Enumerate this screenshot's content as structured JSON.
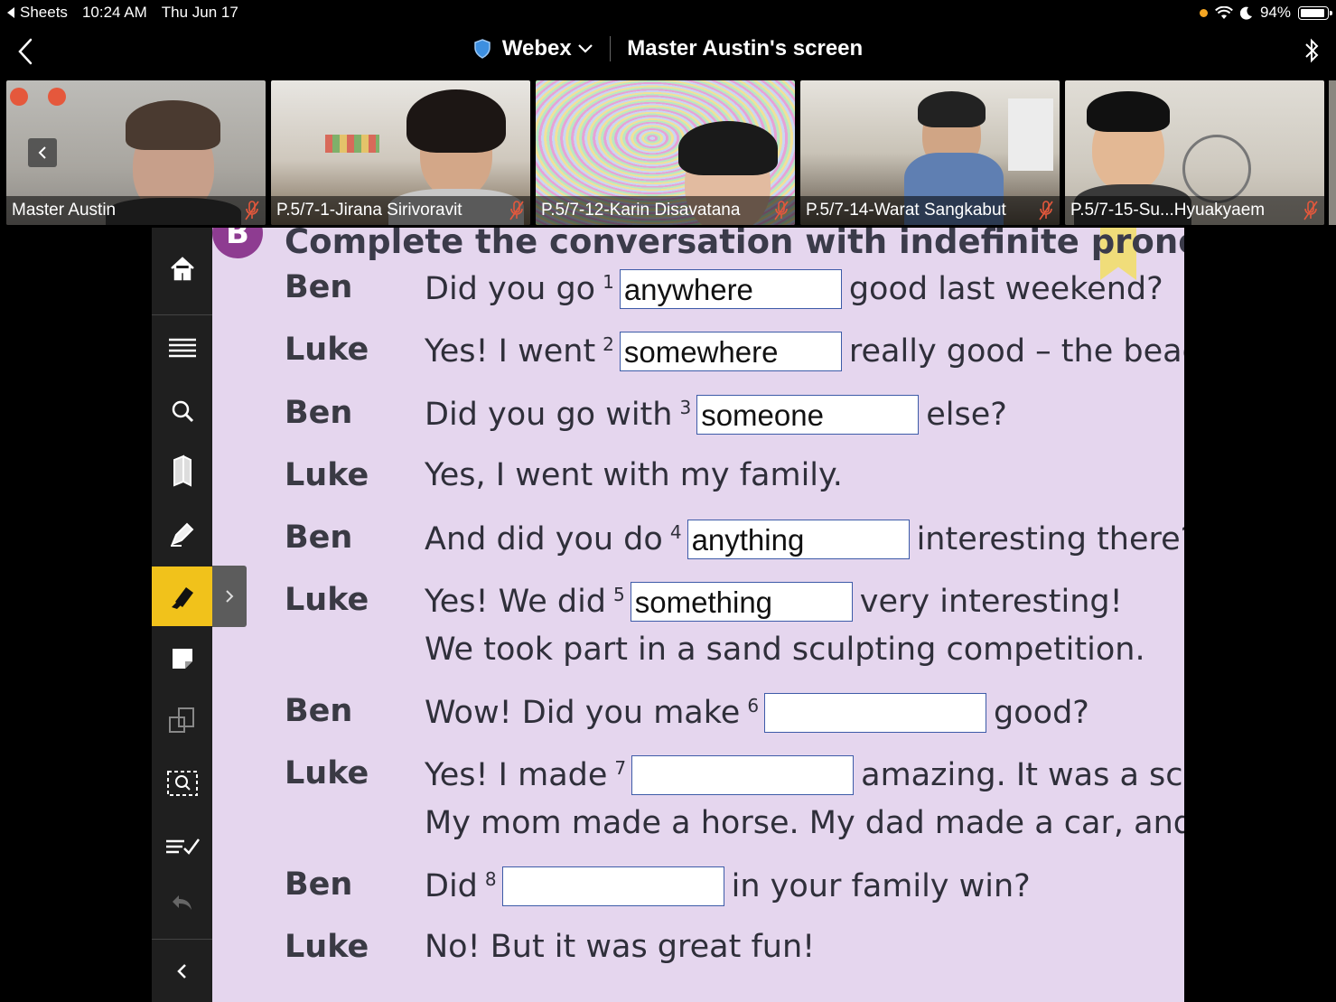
{
  "status_bar": {
    "back_app": "Sheets",
    "time": "10:24 AM",
    "date": "Thu Jun 17",
    "battery": "94%",
    "battery_level": 0.94
  },
  "nav": {
    "app_name": "Webex",
    "screen_title": "Master Austin's screen"
  },
  "participants": [
    {
      "name": "Master Austin"
    },
    {
      "name": "P.5/7-1-Jirana Sirivoravit"
    },
    {
      "name": "P.5/7-12-Karin Disavatana"
    },
    {
      "name": "P.5/7-14-Warat Sangkabut"
    },
    {
      "name": "P.5/7-15-Su...Hyuakyaem"
    }
  ],
  "exercise": {
    "badge": "B",
    "instruction": "Complete the conversation with indefinite pronouns",
    "lines": [
      {
        "speaker": "Ben",
        "before": "Did you go",
        "num": "1",
        "answer": "anywhere",
        "after": "good last weekend?"
      },
      {
        "speaker": "Luke",
        "before": "Yes! I went",
        "num": "2",
        "answer": "somewhere",
        "after": "really good – the beac"
      },
      {
        "speaker": "Ben",
        "before": "Did you go with",
        "num": "3",
        "answer": "someone",
        "after": "else?"
      },
      {
        "speaker": "Luke",
        "before": "Yes, I went with my family.",
        "num": "",
        "answer": "",
        "after": ""
      },
      {
        "speaker": "Ben",
        "before": "And did you do",
        "num": "4",
        "answer": "anything",
        "after": "interesting there?"
      },
      {
        "speaker": "Luke",
        "before": "Yes! We did",
        "num": "5",
        "answer": "something",
        "after": "very interesting!"
      },
      {
        "speaker": "",
        "before": "We took part in a sand sculpting competition.",
        "num": "",
        "answer": "",
        "after": ""
      },
      {
        "speaker": "Ben",
        "before": "Wow! Did you make",
        "num": "6",
        "answer": "",
        "after": "good?"
      },
      {
        "speaker": "Luke",
        "before": "Yes! I made",
        "num": "7",
        "answer": "",
        "after": "amazing. It was a scu"
      },
      {
        "speaker": "",
        "before": "My mom made a horse. My dad made a car, and",
        "num": "",
        "answer": "",
        "after": ""
      },
      {
        "speaker": "Ben",
        "before": "Did",
        "num": "8",
        "answer": "",
        "after": "in your family win?"
      },
      {
        "speaker": "Luke",
        "before": "No! But it was great fun!",
        "num": "",
        "answer": "",
        "after": ""
      }
    ]
  },
  "toolbar": {
    "tools": [
      "home-icon",
      "list-icon",
      "search-icon",
      "bookmarks-icon",
      "pen-icon",
      "highlighter-icon",
      "sticky-note-icon",
      "copy-icon",
      "zoom-area-icon",
      "answers-icon",
      "undo-icon",
      "collapse-icon"
    ],
    "active_tool": "highlighter-icon"
  }
}
